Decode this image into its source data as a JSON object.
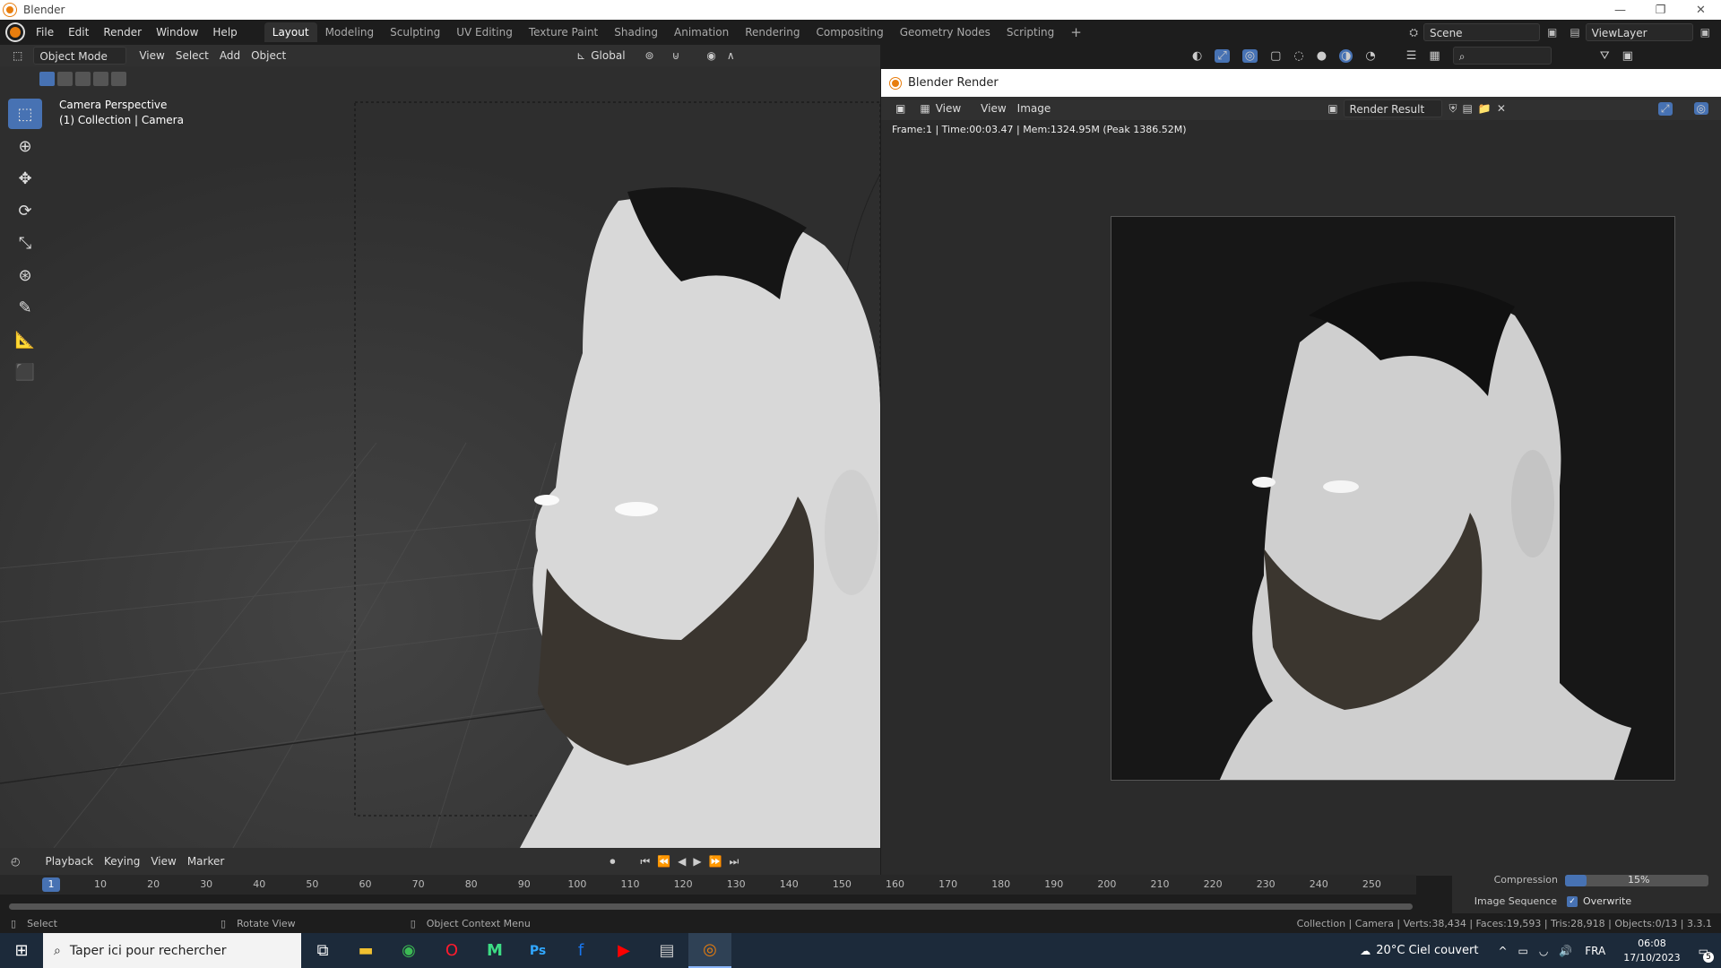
{
  "window": {
    "title": "Blender",
    "minimize": "—",
    "restore": "❐",
    "close": "✕"
  },
  "menu": [
    "File",
    "Edit",
    "Render",
    "Window",
    "Help"
  ],
  "workspaces": [
    "Layout",
    "Modeling",
    "Sculpting",
    "UV Editing",
    "Texture Paint",
    "Shading",
    "Animation",
    "Rendering",
    "Compositing",
    "Geometry Nodes",
    "Scripting"
  ],
  "workspace_add": "+",
  "scene": {
    "label": "Scene",
    "view_layer": "ViewLayer"
  },
  "viewport_header": {
    "mode": "Object Mode",
    "items": [
      "View",
      "Select",
      "Add",
      "Object"
    ],
    "orientation": "Global"
  },
  "viewport_overlay": {
    "line1": "Camera Perspective",
    "line2": "(1) Collection | Camera"
  },
  "render_window": {
    "title": "Blender Render",
    "menu": [
      "View",
      "View",
      "Image"
    ],
    "slot": "Render Result",
    "info": "Frame:1 | Time:00:03.47 | Mem:1324.95M (Peak 1386.52M)"
  },
  "timeline": {
    "items": [
      "Playback",
      "Keying",
      "View",
      "Marker"
    ],
    "current_frame": "1",
    "ticks": [
      "10",
      "20",
      "30",
      "40",
      "50",
      "60",
      "70",
      "80",
      "90",
      "100",
      "110",
      "120",
      "130",
      "140",
      "150",
      "160",
      "170",
      "180",
      "190",
      "200",
      "210",
      "220",
      "230",
      "240",
      "250"
    ]
  },
  "properties_fragment": {
    "compression_label": "Compression",
    "compression_value": "15%",
    "image_sequence_label": "Image Sequence",
    "overwrite_label": "Overwrite"
  },
  "status": {
    "select": "Select",
    "rotate": "Rotate View",
    "context": "Object Context Menu",
    "stats": "Collection | Camera | Verts:38,434 | Faces:19,593 | Tris:28,918 | Objects:0/13 | 3.3.1"
  },
  "taskbar": {
    "search_placeholder": "Taper ici pour rechercher",
    "weather": "20°C  Ciel couvert",
    "lang": "FRA",
    "time": "06:08",
    "date": "17/10/2023",
    "notif_count": "5"
  },
  "colors": {
    "accent": "#4772b3",
    "blender_orange": "#e87d0d"
  }
}
